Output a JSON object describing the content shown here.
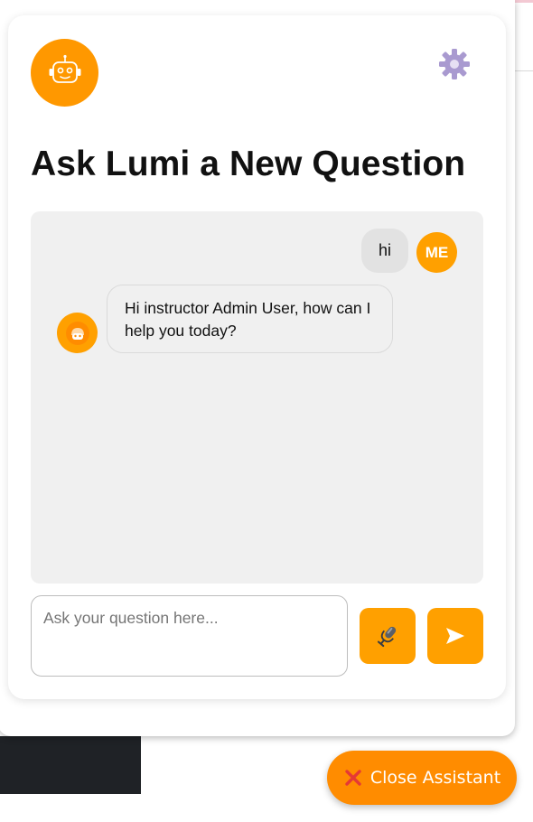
{
  "panel": {
    "title": "Ask Lumi a New Question",
    "icons": {
      "assistant": "robot-avatar-icon",
      "settings": "gear-icon"
    }
  },
  "chat": {
    "messages": [
      {
        "sender": "user",
        "avatar_label": "ME",
        "text": "hi"
      },
      {
        "sender": "assistant",
        "text": "Hi instructor Admin User, how can I help you today?"
      }
    ]
  },
  "composer": {
    "placeholder": "Ask your question here...",
    "value": "",
    "mic_icon": "microphone-icon",
    "send_icon": "send-arrow-icon"
  },
  "footer": {
    "close_label": "Close Assistant",
    "close_icon": "red-x-icon"
  },
  "colors": {
    "accent": "#ffa000",
    "accent_dark": "#ff8c00",
    "chat_bg": "#f0f0f0",
    "close_x": "#e53935"
  }
}
